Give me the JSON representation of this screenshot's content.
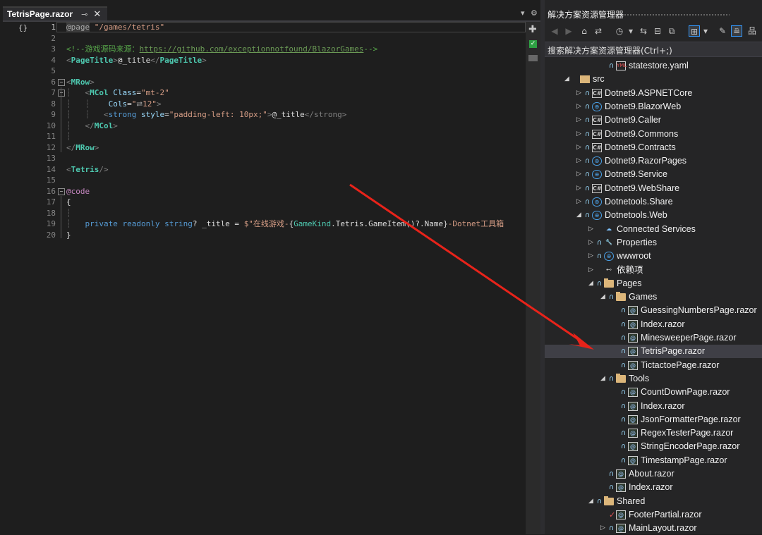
{
  "editor": {
    "tab_title": "TetrisPage.razor",
    "pin_icon": "pin-icon",
    "close_icon": "close-icon",
    "margin_label": "{}",
    "line_numbers": [
      "1",
      "2",
      "3",
      "4",
      "5",
      "6",
      "7",
      "8",
      "9",
      "10",
      "11",
      "12",
      "13",
      "14",
      "15",
      "16",
      "17",
      "18",
      "19",
      "20"
    ],
    "code": {
      "l1_razor": "@page",
      "l1_str": " \"/games/tetris\"",
      "l3_comment_start": "<!--游戏源码来源：",
      "l3_link": "https://github.com/exceptionnotfound/BlazorGames",
      "l3_comment_end": "-->",
      "l4_open": "<",
      "l4_comp": "PageTitle",
      "l4_close": ">",
      "l4_expr": "@_title",
      "l4_end_open": "</",
      "l4_end_comp": "PageTitle",
      "l4_end_close": ">",
      "l6_open": "<",
      "l6_comp": "MRow",
      "l6_close": ">",
      "l7_open": "<",
      "l7_comp": "MCol",
      "l7_attr": " Class",
      "l7_eq": "=",
      "l7_val": "\"mt-2\"",
      "l8_attr": "Cols",
      "l8_eq": "=",
      "l8_val_open": "\"",
      "l8_hint": "⮂",
      "l8_val": "12\"",
      "l8_close": ">",
      "l9_open": "<",
      "l9_tag": "strong",
      "l9_attr": " style",
      "l9_eq": "=",
      "l9_val": "\"padding-left: 10px;\"",
      "l9_close": ">",
      "l9_expr": "@_title",
      "l9_end": "</strong>",
      "l10_end_open": "</",
      "l10_comp": "MCol",
      "l10_end_close": ">",
      "l12_end_open": "</",
      "l12_comp": "MRow",
      "l12_end_close": ">",
      "l14_open": "<",
      "l14_comp": "Tetris",
      "l14_close": "/>",
      "l16_code": "@code",
      "l17": "{",
      "l19_kw1": "private",
      "l19_kw2": " readonly",
      "l19_kw3": " string",
      "l19_rest": "? _title = ",
      "l19_str1": "$\"在线游戏-",
      "l19_brace1": "{",
      "l19_type": "GameKind",
      "l19_dot": ".Tetris.",
      "l19_method": "GameItem",
      "l19_rest2": "()?.Name",
      "l19_brace2": "}",
      "l19_str2": "-Dotnet工具箱",
      "l20": "}"
    }
  },
  "solution_explorer": {
    "title": "解决方案资源管理器",
    "search_placeholder": "搜索解决方案资源管理器(Ctrl+;)",
    "toolbar_icons": [
      "back-icon",
      "forward-icon",
      "home-icon",
      "switch-views-icon",
      "history-icon",
      "dropdown-icon",
      "sync-icon",
      "collapse-all-icon",
      "show-all-files-icon",
      "preview-selected-icon",
      "dropdown-icon",
      "properties-icon",
      "pending-changes-icon",
      "new-view-icon"
    ],
    "tree": [
      {
        "label": "statestore.yaml",
        "icon": "yml",
        "lock": true,
        "depth": 3,
        "arrow": ""
      },
      {
        "label": "src",
        "icon": "srcf",
        "lock": false,
        "depth": 0,
        "arrow": "down"
      },
      {
        "label": "Dotnet9.ASPNETCore",
        "icon": "proj",
        "lock": true,
        "depth": 1,
        "arrow": "right"
      },
      {
        "label": "Dotnet9.BlazorWeb",
        "icon": "web",
        "lock": true,
        "depth": 1,
        "arrow": "right"
      },
      {
        "label": "Dotnet9.Caller",
        "icon": "proj",
        "lock": true,
        "depth": 1,
        "arrow": "right"
      },
      {
        "label": "Dotnet9.Commons",
        "icon": "proj",
        "lock": true,
        "depth": 1,
        "arrow": "right"
      },
      {
        "label": "Dotnet9.Contracts",
        "icon": "proj",
        "lock": true,
        "depth": 1,
        "arrow": "right"
      },
      {
        "label": "Dotnet9.RazorPages",
        "icon": "web",
        "lock": true,
        "depth": 1,
        "arrow": "right"
      },
      {
        "label": "Dotnet9.Service",
        "icon": "web",
        "lock": true,
        "depth": 1,
        "arrow": "right"
      },
      {
        "label": "Dotnet9.WebShare",
        "icon": "proj",
        "lock": true,
        "depth": 1,
        "arrow": "right"
      },
      {
        "label": "Dotnetools.Share",
        "icon": "web",
        "lock": true,
        "depth": 1,
        "arrow": "right"
      },
      {
        "label": "Dotnetools.Web",
        "icon": "web",
        "lock": true,
        "depth": 1,
        "arrow": "down"
      },
      {
        "label": "Connected Services",
        "icon": "svc",
        "lock": false,
        "depth": 2,
        "arrow": "right"
      },
      {
        "label": "Properties",
        "icon": "props",
        "lock": true,
        "depth": 2,
        "arrow": "right"
      },
      {
        "label": "wwwroot",
        "icon": "globe",
        "lock": true,
        "depth": 2,
        "arrow": "right"
      },
      {
        "label": "依赖项",
        "icon": "deps",
        "lock": false,
        "depth": 2,
        "arrow": "right"
      },
      {
        "label": "Pages",
        "icon": "folder",
        "lock": true,
        "depth": 2,
        "arrow": "down"
      },
      {
        "label": "Games",
        "icon": "folder",
        "lock": true,
        "depth": 3,
        "arrow": "down"
      },
      {
        "label": "GuessingNumbersPage.razor",
        "icon": "razor",
        "lock": true,
        "depth": 4,
        "arrow": ""
      },
      {
        "label": "Index.razor",
        "icon": "razor",
        "lock": true,
        "depth": 4,
        "arrow": ""
      },
      {
        "label": "MinesweeperPage.razor",
        "icon": "razor",
        "lock": true,
        "depth": 4,
        "arrow": ""
      },
      {
        "label": "TetrisPage.razor",
        "icon": "razor",
        "lock": true,
        "depth": 4,
        "arrow": "",
        "selected": true
      },
      {
        "label": "TictactoePage.razor",
        "icon": "razor",
        "lock": true,
        "depth": 4,
        "arrow": ""
      },
      {
        "label": "Tools",
        "icon": "folder",
        "lock": true,
        "depth": 3,
        "arrow": "down"
      },
      {
        "label": "CountDownPage.razor",
        "icon": "razor",
        "lock": true,
        "depth": 4,
        "arrow": ""
      },
      {
        "label": "Index.razor",
        "icon": "razor",
        "lock": true,
        "depth": 4,
        "arrow": ""
      },
      {
        "label": "JsonFormatterPage.razor",
        "icon": "razor",
        "lock": true,
        "depth": 4,
        "arrow": ""
      },
      {
        "label": "RegexTesterPage.razor",
        "icon": "razor",
        "lock": true,
        "depth": 4,
        "arrow": ""
      },
      {
        "label": "StringEncoderPage.razor",
        "icon": "razor",
        "lock": true,
        "depth": 4,
        "arrow": ""
      },
      {
        "label": "TimestampPage.razor",
        "icon": "razor",
        "lock": true,
        "depth": 4,
        "arrow": ""
      },
      {
        "label": "About.razor",
        "icon": "razor",
        "lock": true,
        "depth": 3,
        "arrow": ""
      },
      {
        "label": "Index.razor",
        "icon": "razor",
        "lock": true,
        "depth": 3,
        "arrow": ""
      },
      {
        "label": "Shared",
        "icon": "folder",
        "lock": true,
        "depth": 2,
        "arrow": "down"
      },
      {
        "label": "FooterPartial.razor",
        "icon": "razor",
        "lock": false,
        "check": true,
        "depth": 3,
        "arrow": ""
      },
      {
        "label": "MainLayout.razor",
        "icon": "razor",
        "lock": true,
        "depth": 3,
        "arrow": "right"
      }
    ]
  },
  "annotation_color": "#e8231a"
}
